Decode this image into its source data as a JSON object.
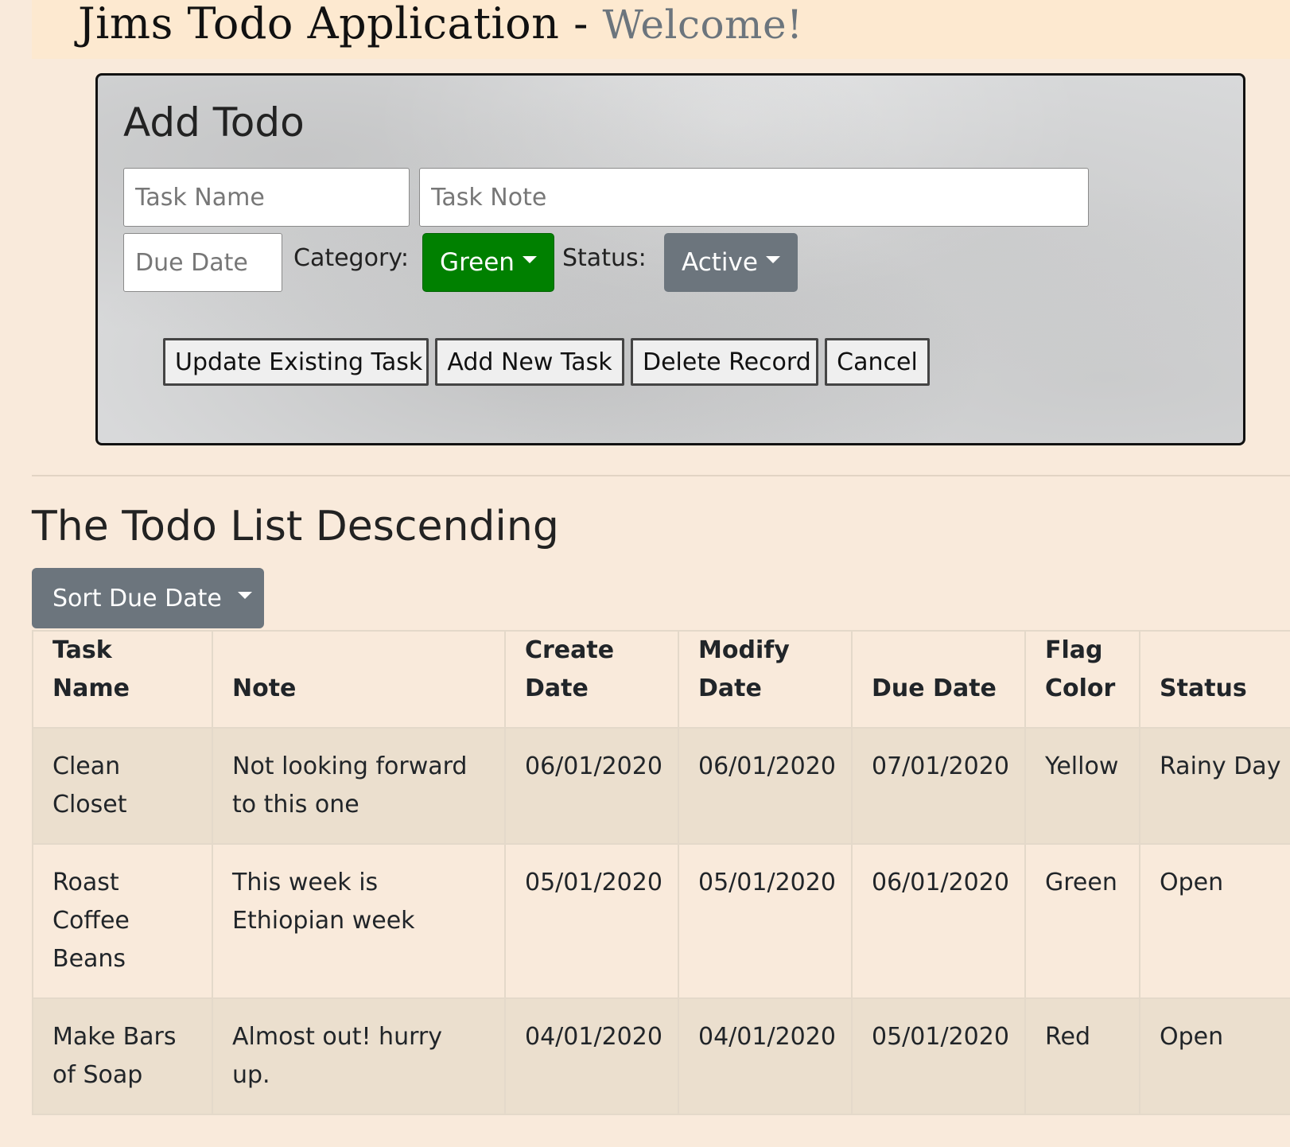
{
  "header": {
    "title": "Jims Todo Application -",
    "welcome": "Welcome!"
  },
  "add_form": {
    "title": "Add Todo",
    "task_name_placeholder": "Task Name",
    "task_note_placeholder": "Task Note",
    "due_date_placeholder": "Due Date",
    "category_label": "Category:",
    "category_value": "Green",
    "category_color": "#008000",
    "status_label": "Status:",
    "status_value": "Active",
    "buttons": {
      "update": "Update Existing Task",
      "add": "Add New Task",
      "delete": "Delete Record",
      "cancel": "Cancel"
    }
  },
  "list": {
    "title": "The Todo List Descending",
    "sort_label": "Sort Due Date",
    "columns": [
      "Task Name",
      "Note",
      "Create Date",
      "Modify Date",
      "Due Date",
      "Flag Color",
      "Status"
    ],
    "rows": [
      [
        "Clean Closet",
        "Not looking forward to this one",
        "06/01/2020",
        "06/01/2020",
        "07/01/2020",
        "Yellow",
        "Rainy Day"
      ],
      [
        "Roast Coffee Beans",
        "This week is Ethiopian week",
        "05/01/2020",
        "05/01/2020",
        "06/01/2020",
        "Green",
        "Open"
      ],
      [
        "Make Bars of Soap",
        "Almost out! hurry up.",
        "04/01/2020",
        "04/01/2020",
        "05/01/2020",
        "Red",
        "Open"
      ]
    ]
  }
}
